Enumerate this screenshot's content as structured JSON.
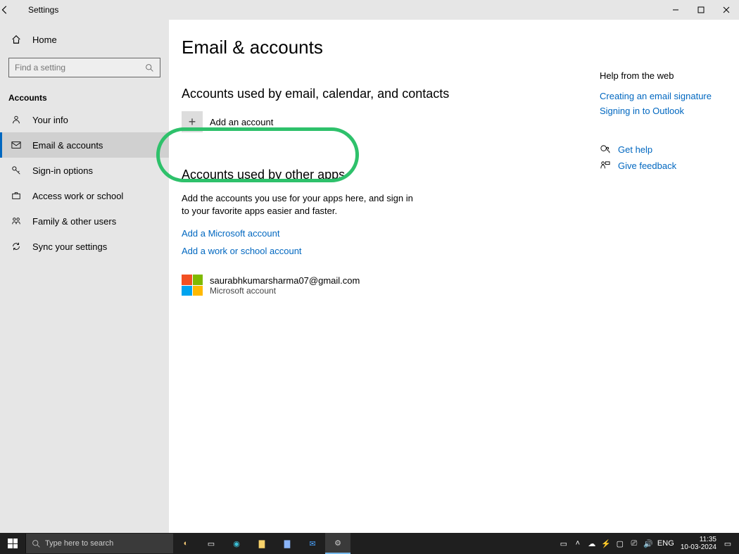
{
  "window": {
    "title": "Settings"
  },
  "sidebar": {
    "home": "Home",
    "search_placeholder": "Find a setting",
    "section": "Accounts",
    "items": [
      {
        "label": "Your info"
      },
      {
        "label": "Email & accounts"
      },
      {
        "label": "Sign-in options"
      },
      {
        "label": "Access work or school"
      },
      {
        "label": "Family & other users"
      },
      {
        "label": "Sync your settings"
      }
    ],
    "active_index": 1
  },
  "main": {
    "page_title": "Email & accounts",
    "section1_title": "Accounts used by email, calendar, and contacts",
    "add_account": "Add an account",
    "section2_title": "Accounts used by other apps",
    "section2_desc": "Add the accounts you use for your apps here, and sign in to your favorite apps easier and faster.",
    "link_add_ms": "Add a Microsoft account",
    "link_add_work": "Add a work or school account",
    "account": {
      "email": "saurabhkumarsharma07@gmail.com",
      "type": "Microsoft account"
    }
  },
  "right": {
    "help_title": "Help from the web",
    "links": [
      "Creating an email signature",
      "Signing in to Outlook"
    ],
    "get_help": "Get help",
    "give_feedback": "Give feedback"
  },
  "taskbar": {
    "search_placeholder": "Type here to search",
    "lang": "ENG",
    "time": "11:35",
    "date": "10-03-2024"
  }
}
